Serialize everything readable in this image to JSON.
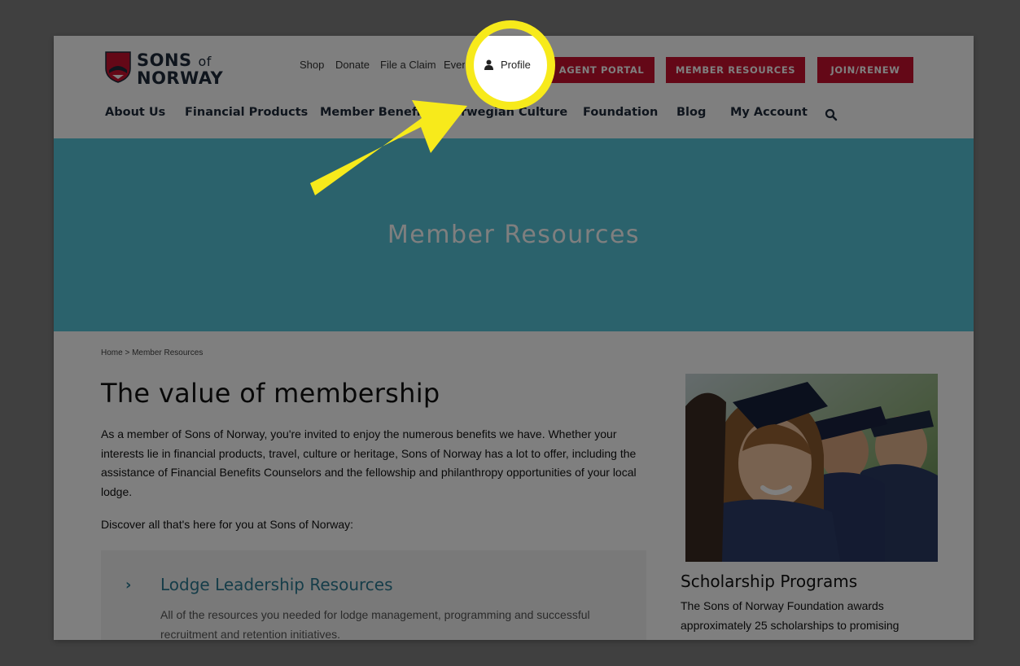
{
  "site": {
    "logo_top": "SONS",
    "logo_of": "of",
    "logo_bottom": "NORWAY",
    "logo_shield_text": "S★N"
  },
  "utility_nav": {
    "shop": "Shop",
    "donate": "Donate",
    "file_claim": "File a Claim",
    "events": "Events",
    "profile": "Profile"
  },
  "buttons": {
    "agent_portal": "AGENT PORTAL",
    "member_resources": "MEMBER RESOURCES",
    "join_renew": "JOIN/RENEW"
  },
  "main_nav": {
    "about": "About Us",
    "financial": "Financial Products",
    "member_benefits": "Member Benefits",
    "culture": "Norwegian Culture",
    "foundation": "Foundation",
    "blog": "Blog",
    "account": "My Account"
  },
  "hero": {
    "title": "Member Resources"
  },
  "breadcrumb": "Home > Member Resources",
  "content": {
    "heading": "The value of membership",
    "intro": "As a member of Sons of Norway, you're invited to enjoy the numerous benefits we have. Whether your interests lie in financial products, travel, culture or heritage, Sons of Norway has a lot to offer, including the assistance of Financial Benefits Counselors and the fellowship and philanthropy opportunities of your local lodge.",
    "discover": "Discover all that's here for you at Sons of Norway:",
    "card_title": "Lodge Leadership Resources",
    "card_desc": "All of the resources you needed for lodge management, programming and successful recruitment and retention initiatives."
  },
  "sidebar": {
    "title": "Scholarship Programs",
    "desc": "The Sons of Norway Foundation awards approximately 25 scholarships to promising"
  },
  "colors": {
    "brand_red": "#c8102e",
    "hero_teal": "#57c5d9",
    "link_teal": "#2c7b93",
    "highlight_yellow": "#f7ea1b"
  },
  "icons": {
    "profile": "person-icon",
    "search": "search-icon",
    "chevron": "chevron-right-icon",
    "annotation": "yellow-arrow-icon"
  }
}
